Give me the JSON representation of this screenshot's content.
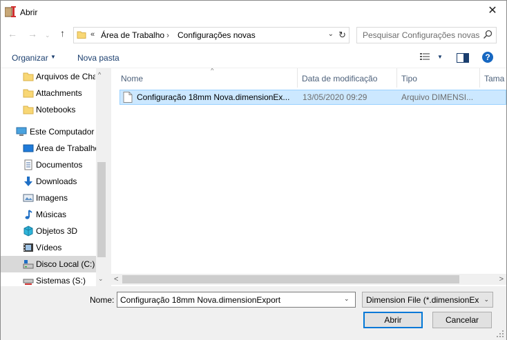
{
  "window": {
    "title": "Abrir",
    "close_glyph": "✕"
  },
  "navigation": {
    "back_glyph": "←",
    "forward_glyph": "→",
    "recent_glyph": "⌄",
    "up_glyph": "↑",
    "address": {
      "overflow_glyph": "«",
      "crumbs": [
        "Área de Trabalho",
        "Configurações novas"
      ],
      "separator": "›",
      "dropdown_glyph": "⌄",
      "refresh_glyph": "↻"
    },
    "search": {
      "placeholder": "Pesquisar Configurações novas"
    }
  },
  "toolbar": {
    "organize_label": "Organizar",
    "arrow_glyph": "▼",
    "new_folder_label": "Nova pasta",
    "help_glyph": "?"
  },
  "sidebar": {
    "items": [
      {
        "label": "Arquivos de Chat",
        "icon": "folder-icon"
      },
      {
        "label": "Attachments",
        "icon": "folder-icon"
      },
      {
        "label": "Notebooks",
        "icon": "folder-icon"
      },
      {
        "label": "Este Computador",
        "icon": "computer-icon"
      },
      {
        "label": "Área de Trabalho",
        "icon": "desktop-icon"
      },
      {
        "label": "Documentos",
        "icon": "documents-icon"
      },
      {
        "label": "Downloads",
        "icon": "download-icon"
      },
      {
        "label": "Imagens",
        "icon": "pictures-icon"
      },
      {
        "label": "Músicas",
        "icon": "music-icon"
      },
      {
        "label": "Objetos 3D",
        "icon": "3d-objects-icon"
      },
      {
        "label": "Vídeos",
        "icon": "videos-icon"
      },
      {
        "label": "Disco Local (C:)",
        "icon": "drive-icon"
      },
      {
        "label": "Sistemas (S:)",
        "icon": "network-drive-icon"
      }
    ],
    "selected_index": 11,
    "scroll_up_glyph": "^",
    "scroll_down_glyph": "⌄"
  },
  "file_list": {
    "columns": [
      "Nome",
      "Data de modificação",
      "Tipo",
      "Tama"
    ],
    "sort_glyph": "^",
    "rows": [
      {
        "name": "Configuração 18mm Nova.dimensionEx...",
        "modified": "13/05/2020 09:29",
        "type": "Arquivo DIMENSI..."
      }
    ],
    "scroll_left_glyph": "<",
    "scroll_right_glyph": ">"
  },
  "footer": {
    "name_label": "Nome:",
    "file_name_value": "Configuração 18mm Nova.dimensionExport",
    "dropdown_glyph": "⌄",
    "file_type_filter": "Dimension File  (*.dimensionEx",
    "open_label": "Abrir",
    "cancel_label": "Cancelar"
  },
  "colors": {
    "selection_bg": "#cce8ff",
    "selection_border": "#99d1ff",
    "accent": "#0078d7",
    "folder": "#f8d775",
    "link_text": "#1a3e6e"
  }
}
